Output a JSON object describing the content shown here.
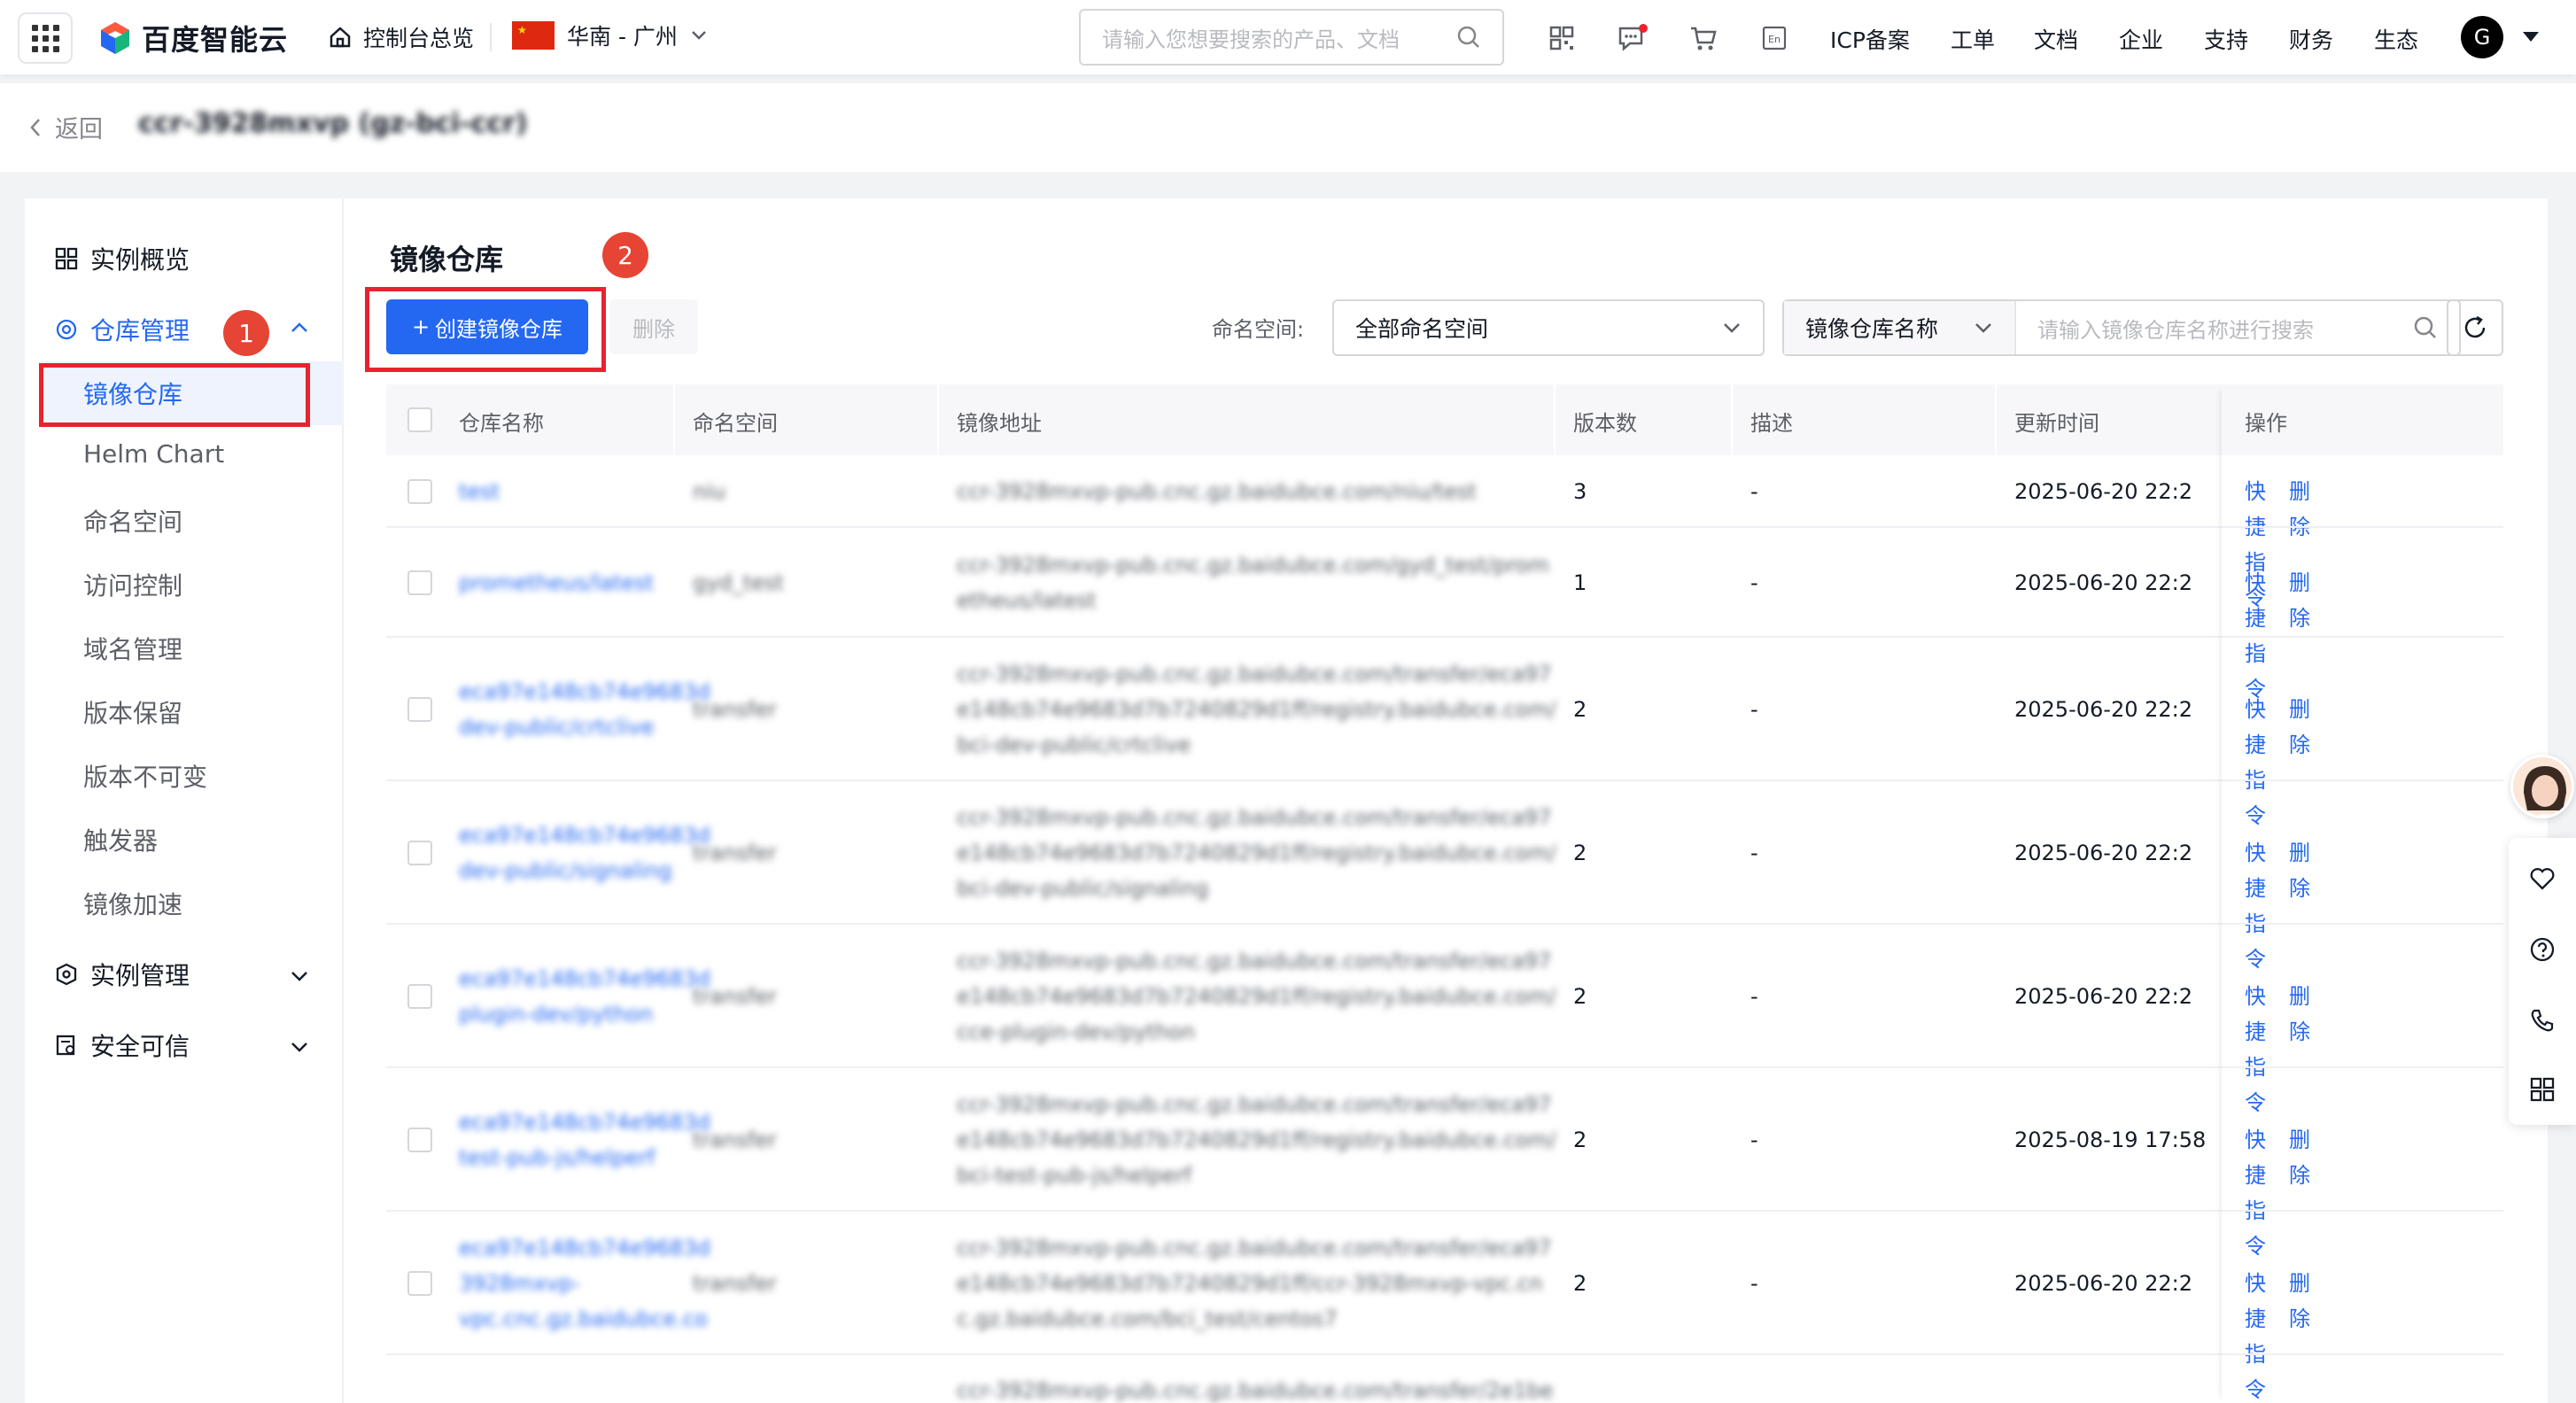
{
  "header": {
    "logo_text": "百度智能云",
    "home_label": "控制台总览",
    "region_label": "华南 - 广州",
    "search_placeholder": "请输入您想要搜索的产品、文档",
    "links": [
      "ICP备案",
      "工单",
      "文档",
      "企业",
      "支持",
      "财务",
      "生态"
    ],
    "avatar_letter": "G"
  },
  "breadcrumb": {
    "back_label": "返回",
    "instance_title": "ccr-3928mxvp (gz-bci-ccr)"
  },
  "sidebar": {
    "overview": "实例概览",
    "repo_mgmt": "仓库管理",
    "sub_items": [
      "镜像仓库",
      "Helm Chart",
      "命名空间",
      "访问控制",
      "域名管理",
      "版本保留",
      "版本不可变",
      "触发器",
      "镜像加速"
    ],
    "instance_mgmt": "实例管理",
    "security": "安全可信"
  },
  "badges": {
    "one": "1",
    "two": "2"
  },
  "main": {
    "title": "镜像仓库",
    "create_button": "创建镜像仓库",
    "delete_button": "删除",
    "namespace_label": "命名空间:",
    "namespace_value": "全部命名空间",
    "search_field": "镜像仓库名称",
    "search_placeholder": "请输入镜像仓库名称进行搜索"
  },
  "table": {
    "columns": [
      "仓库名称",
      "命名空间",
      "镜像地址",
      "版本数",
      "描述",
      "更新时间",
      "操作"
    ],
    "action_quick": "快捷指令",
    "action_delete": "删除",
    "rows": [
      {
        "name": [
          "test"
        ],
        "ns": "niu",
        "addr": [
          "ccr-3928mxvp-pub.cnc.gz.baidubce.com/niu/test"
        ],
        "versions": "3",
        "desc": "-",
        "updated": "2025-06-20 22:2"
      },
      {
        "name": [
          "prometheus/latest"
        ],
        "ns": "gyd_test",
        "addr": [
          "ccr-3928mxvp-pub.cnc.gz.baidubce.com/gyd_test/prom",
          "etheus/latest"
        ],
        "versions": "1",
        "desc": "-",
        "updated": "2025-06-20 22:2"
      },
      {
        "name": [
          "eca97e148cb74e9683d",
          "dev-public/crtclive"
        ],
        "ns": "transfer",
        "addr": [
          "ccr-3928mxvp-pub.cnc.gz.baidubce.com/transfer/eca97",
          "e148cb74e9683d7b7240829d1ff/registry.baidubce.com/",
          "bci-dev-public/crtclive"
        ],
        "versions": "2",
        "desc": "-",
        "updated": "2025-06-20 22:2"
      },
      {
        "name": [
          "eca97e148cb74e9683d",
          "dev-public/signaling"
        ],
        "ns": "transfer",
        "addr": [
          "ccr-3928mxvp-pub.cnc.gz.baidubce.com/transfer/eca97",
          "e148cb74e9683d7b7240829d1ff/registry.baidubce.com/",
          "bci-dev-public/signaling"
        ],
        "versions": "2",
        "desc": "-",
        "updated": "2025-06-20 22:2"
      },
      {
        "name": [
          "eca97e148cb74e9683d",
          "plugin-dev/python"
        ],
        "ns": "transfer",
        "addr": [
          "ccr-3928mxvp-pub.cnc.gz.baidubce.com/transfer/eca97",
          "e148cb74e9683d7b7240829d1ff/registry.baidubce.com/",
          "cce-plugin-dev/python"
        ],
        "versions": "2",
        "desc": "-",
        "updated": "2025-06-20 22:2"
      },
      {
        "name": [
          "eca97e148cb74e9683d",
          "test-pub-js/helperf"
        ],
        "ns": "transfer",
        "addr": [
          "ccr-3928mxvp-pub.cnc.gz.baidubce.com/transfer/eca97",
          "e148cb74e9683d7b7240829d1ff/registry.baidubce.com/",
          "bci-test-pub-js/helperf"
        ],
        "versions": "2",
        "desc": "-",
        "updated": "2025-08-19 17:58"
      },
      {
        "name": [
          "eca97e148cb74e9683d",
          "3928mxvp-",
          "vpc.cnc.gz.baidubce.co"
        ],
        "ns": "transfer",
        "addr": [
          "ccr-3928mxvp-pub.cnc.gz.baidubce.com/transfer/eca97",
          "e148cb74e9683d7b7240829d1ff/ccr-3928mxvp-vpc.cn",
          "c.gz.baidubce.com/bci_test/centos7"
        ],
        "versions": "2",
        "desc": "-",
        "updated": "2025-06-20 22:2"
      },
      {
        "name": [
          ""
        ],
        "ns": "",
        "addr": [
          "ccr-3928mxvp-pub.cnc.gz.baidubce.com/transfer/2e1be"
        ],
        "versions": "",
        "desc": "",
        "updated": ""
      }
    ]
  },
  "colors": {
    "accent": "#2468f2",
    "highlight": "#e8232e",
    "badge": "#e64434"
  }
}
